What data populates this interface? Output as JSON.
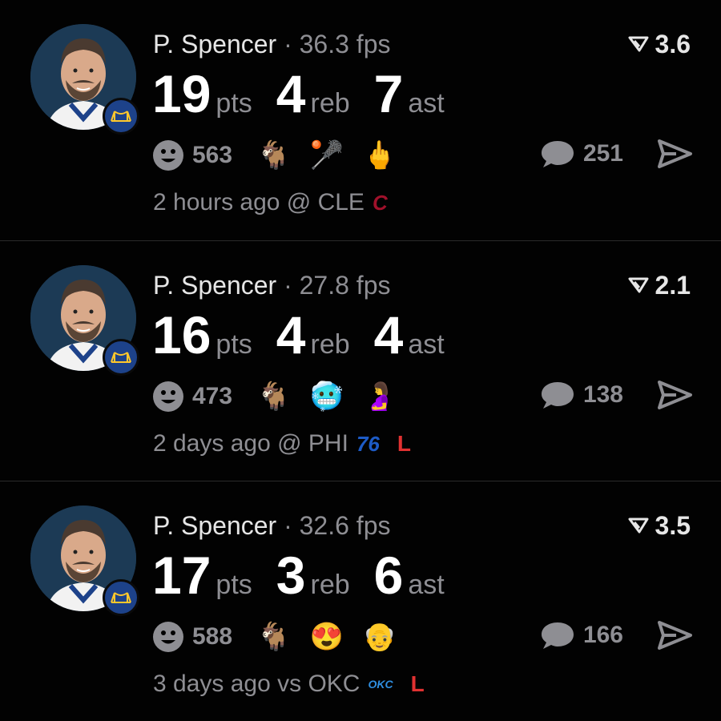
{
  "posts": [
    {
      "player_name": "P. Spencer",
      "separator": "·",
      "fps": "36.3 fps",
      "rating": "3.6",
      "stats": [
        {
          "value": "19",
          "unit": "pts"
        },
        {
          "value": "4",
          "unit": "reb"
        },
        {
          "value": "7",
          "unit": "ast"
        }
      ],
      "reaction_count": "563",
      "emojis": [
        "🐐",
        "🥍",
        "🖕"
      ],
      "comment_count": "251",
      "time_ago": "2 hours ago",
      "matchup": "@ CLE",
      "opponent_logo_text": "C",
      "opponent_logo_color": "#a0112b",
      "result": ""
    },
    {
      "player_name": "P. Spencer",
      "separator": "·",
      "fps": "27.8 fps",
      "rating": "2.1",
      "stats": [
        {
          "value": "16",
          "unit": "pts"
        },
        {
          "value": "4",
          "unit": "reb"
        },
        {
          "value": "4",
          "unit": "ast"
        }
      ],
      "reaction_count": "473",
      "emojis": [
        "🐐",
        "🥶",
        "🤰"
      ],
      "comment_count": "138",
      "time_ago": "2 days ago",
      "matchup": "@ PHI",
      "opponent_logo_text": "76",
      "opponent_logo_color": "#1d5bc6",
      "result": "L"
    },
    {
      "player_name": "P. Spencer",
      "separator": "·",
      "fps": "32.6 fps",
      "rating": "3.5",
      "stats": [
        {
          "value": "17",
          "unit": "pts"
        },
        {
          "value": "3",
          "unit": "reb"
        },
        {
          "value": "6",
          "unit": "ast"
        }
      ],
      "reaction_count": "588",
      "emojis": [
        "🐐",
        "😍",
        "👴"
      ],
      "comment_count": "166",
      "time_ago": "3 days ago",
      "matchup": "vs OKC",
      "opponent_logo_text": "OKC",
      "opponent_logo_color": "#2f8ee0",
      "result": "L"
    }
  ],
  "colors": {
    "background": "#000000",
    "muted_text": "#8e8e93",
    "loss_red": "#e03131",
    "team_badge": "#1d428a"
  }
}
